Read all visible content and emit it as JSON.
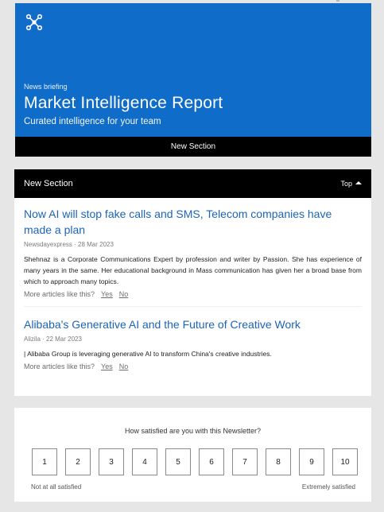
{
  "hero": {
    "eyebrow": "News briefing",
    "title": "Market Intelligence Report",
    "subtitle": "Curated intelligence for your team"
  },
  "nav": {
    "item": "New Section"
  },
  "section": {
    "title": "New Section",
    "top_label": "Top",
    "articles": [
      {
        "headline": "Now AI will stop fake calls and SMS, Telecom companies have made a plan",
        "meta": "Newsdayexpress · 28 Mar 2023",
        "snippet": "Shehnaz is a Corporate Communications Expert by profession and writer by Passion. She has experience of many years in the same. Her educational background in Mass communication has given her a broad base from which to approach many topics.",
        "more_prompt": "More articles like this?",
        "yes": "Yes",
        "no": "No"
      },
      {
        "headline": "Alibaba's Generative AI and the Future of Creative Work",
        "meta": "Alizila · 22 Mar 2023",
        "snippet": "| Alibaba Group is leveraging generative AI to transform China's creative industries.",
        "more_prompt": "More articles like this?",
        "yes": "Yes",
        "no": "No"
      }
    ]
  },
  "survey": {
    "question": "How satisfied are you with this Newsletter?",
    "scale": [
      "1",
      "2",
      "3",
      "4",
      "5",
      "6",
      "7",
      "8",
      "9",
      "10"
    ],
    "low_label": "Not at all satisfied",
    "high_label": "Extremely satisfied"
  },
  "colors": {
    "hero_bg": "#0f6cc9",
    "link_blue": "#1c64b7",
    "black_bar": "#000000"
  },
  "icons": {
    "logo": "network-nodes-icon",
    "top_arrow": "triangle-up-icon"
  }
}
